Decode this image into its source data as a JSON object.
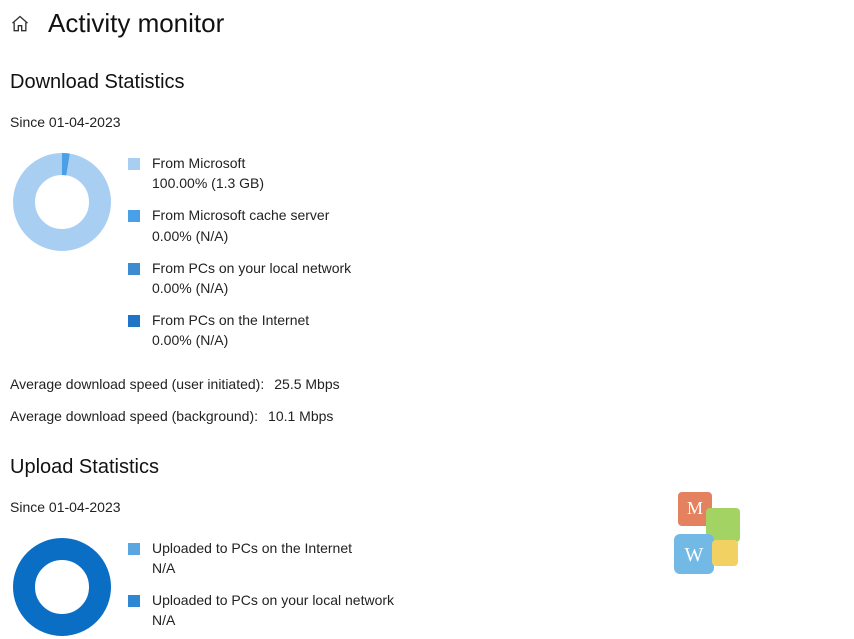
{
  "page_title": "Activity monitor",
  "download": {
    "section_title": "Download Statistics",
    "since": "Since 01-04-2023",
    "legend": [
      {
        "label": "From Microsoft",
        "value": "100.00%  (1.3 GB)",
        "color": "#a8cff2"
      },
      {
        "label": "From Microsoft cache server",
        "value": "0.00%  (N/A)",
        "color": "#4aa0e6"
      },
      {
        "label": "From PCs on your local network",
        "value": "0.00%  (N/A)",
        "color": "#3d8bd1"
      },
      {
        "label": "From PCs on the Internet",
        "value": "0.00%  (N/A)",
        "color": "#2074c7"
      }
    ],
    "avg_user_label": "Average download speed (user initiated):",
    "avg_user_value": "25.5 Mbps",
    "avg_bg_label": "Average download speed (background):",
    "avg_bg_value": "10.1 Mbps"
  },
  "upload": {
    "section_title": "Upload Statistics",
    "since": "Since 01-04-2023",
    "legend": [
      {
        "label": "Uploaded to PCs on the Internet",
        "value": "N/A",
        "color": "#5aa6e0"
      },
      {
        "label": "Uploaded to PCs on your local network",
        "value": "N/A",
        "color": "#2f87d3"
      }
    ]
  },
  "chart_data": [
    {
      "type": "pie",
      "title": "Download sources",
      "hole": 0.55,
      "categories": [
        "From Microsoft",
        "From Microsoft cache server",
        "From PCs on your local network",
        "From PCs on the Internet"
      ],
      "values": [
        100.0,
        0.0,
        0.0,
        0.0
      ],
      "colors": [
        "#a8cff2",
        "#4aa0e6",
        "#3d8bd1",
        "#2074c7"
      ]
    },
    {
      "type": "pie",
      "title": "Upload destinations",
      "hole": 0.55,
      "categories": [
        "Uploaded to PCs on the Internet",
        "Uploaded to PCs on your local network"
      ],
      "values": [
        0.0,
        0.0
      ],
      "colors": [
        "#5aa6e0",
        "#2f87d3"
      ],
      "empty_ring_color": "#0a6ec4"
    }
  ],
  "colors": {
    "download_ring": "#a8cff2",
    "download_marker": "#4aa0e6",
    "upload_ring": "#0a6ec4"
  }
}
